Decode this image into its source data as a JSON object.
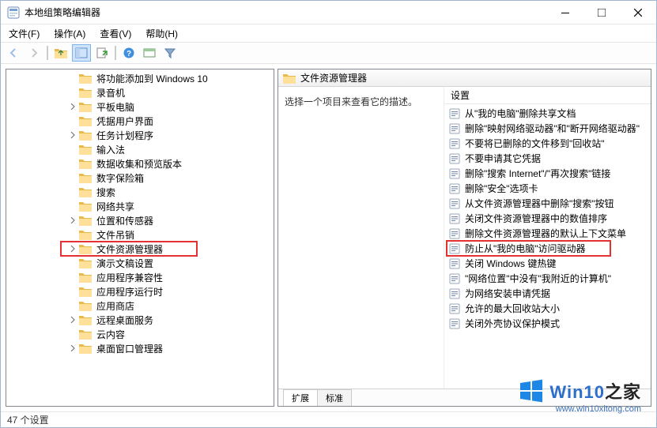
{
  "window": {
    "title": "本地组策略编辑器"
  },
  "menu": {
    "file": "文件(F)",
    "action": "操作(A)",
    "view": "查看(V)",
    "help": "帮助(H)"
  },
  "tree": {
    "items": [
      {
        "label": "将功能添加到 Windows 10",
        "expandable": false
      },
      {
        "label": "录音机",
        "expandable": false
      },
      {
        "label": "平板电脑",
        "expandable": true
      },
      {
        "label": "凭据用户界面",
        "expandable": false
      },
      {
        "label": "任务计划程序",
        "expandable": true
      },
      {
        "label": "输入法",
        "expandable": false
      },
      {
        "label": "数据收集和预览版本",
        "expandable": false
      },
      {
        "label": "数字保险箱",
        "expandable": false
      },
      {
        "label": "搜索",
        "expandable": false
      },
      {
        "label": "网络共享",
        "expandable": false
      },
      {
        "label": "位置和传感器",
        "expandable": true
      },
      {
        "label": "文件吊销",
        "expandable": false
      },
      {
        "label": "文件资源管理器",
        "expandable": true,
        "highlighted": true
      },
      {
        "label": "演示文稿设置",
        "expandable": false
      },
      {
        "label": "应用程序兼容性",
        "expandable": false
      },
      {
        "label": "应用程序运行时",
        "expandable": false
      },
      {
        "label": "应用商店",
        "expandable": false
      },
      {
        "label": "远程桌面服务",
        "expandable": true
      },
      {
        "label": "云内容",
        "expandable": false
      },
      {
        "label": "桌面窗口管理器",
        "expandable": true
      }
    ]
  },
  "detail": {
    "breadcrumb": "文件资源管理器",
    "hint": "选择一个项目来查看它的描述。",
    "col_header": "设置",
    "settings": [
      {
        "label": "从\"我的电脑\"删除共享文档"
      },
      {
        "label": "删除\"映射网络驱动器\"和\"断开网络驱动器\""
      },
      {
        "label": "不要将已删除的文件移到\"回收站\""
      },
      {
        "label": "不要申请其它凭据"
      },
      {
        "label": "删除\"搜索 Internet\"/\"再次搜索\"链接"
      },
      {
        "label": "删除\"安全\"选项卡"
      },
      {
        "label": "从文件资源管理器中删除\"搜索\"按钮"
      },
      {
        "label": "关闭文件资源管理器中的数值排序"
      },
      {
        "label": "删除文件资源管理器的默认上下文菜单"
      },
      {
        "label": "防止从\"我的电脑\"访问驱动器",
        "highlighted": true
      },
      {
        "label": "关闭 Windows 键热键"
      },
      {
        "label": "\"网络位置\"中没有\"我附近的计算机\""
      },
      {
        "label": "为网络安装申请凭据"
      },
      {
        "label": "允许的最大回收站大小"
      },
      {
        "label": "关闭外壳协议保护模式"
      }
    ],
    "tabs": {
      "extended": "扩展",
      "standard": "标准"
    }
  },
  "status": {
    "text": "47 个设置"
  },
  "watermark": {
    "brand": "Win10",
    "suffix": "之家",
    "url": "www.win10xitong.com"
  }
}
